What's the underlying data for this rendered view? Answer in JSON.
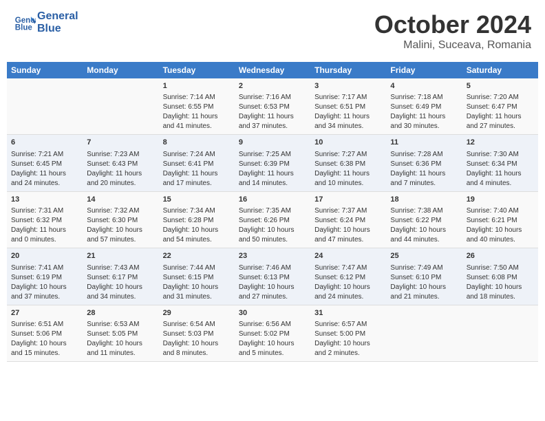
{
  "header": {
    "logo_line1": "General",
    "logo_line2": "Blue",
    "month": "October 2024",
    "location": "Malini, Suceava, Romania"
  },
  "weekdays": [
    "Sunday",
    "Monday",
    "Tuesday",
    "Wednesday",
    "Thursday",
    "Friday",
    "Saturday"
  ],
  "weeks": [
    [
      {
        "day": "",
        "sunrise": "",
        "sunset": "",
        "daylight": ""
      },
      {
        "day": "",
        "sunrise": "",
        "sunset": "",
        "daylight": ""
      },
      {
        "day": "1",
        "sunrise": "Sunrise: 7:14 AM",
        "sunset": "Sunset: 6:55 PM",
        "daylight": "Daylight: 11 hours and 41 minutes."
      },
      {
        "day": "2",
        "sunrise": "Sunrise: 7:16 AM",
        "sunset": "Sunset: 6:53 PM",
        "daylight": "Daylight: 11 hours and 37 minutes."
      },
      {
        "day": "3",
        "sunrise": "Sunrise: 7:17 AM",
        "sunset": "Sunset: 6:51 PM",
        "daylight": "Daylight: 11 hours and 34 minutes."
      },
      {
        "day": "4",
        "sunrise": "Sunrise: 7:18 AM",
        "sunset": "Sunset: 6:49 PM",
        "daylight": "Daylight: 11 hours and 30 minutes."
      },
      {
        "day": "5",
        "sunrise": "Sunrise: 7:20 AM",
        "sunset": "Sunset: 6:47 PM",
        "daylight": "Daylight: 11 hours and 27 minutes."
      }
    ],
    [
      {
        "day": "6",
        "sunrise": "Sunrise: 7:21 AM",
        "sunset": "Sunset: 6:45 PM",
        "daylight": "Daylight: 11 hours and 24 minutes."
      },
      {
        "day": "7",
        "sunrise": "Sunrise: 7:23 AM",
        "sunset": "Sunset: 6:43 PM",
        "daylight": "Daylight: 11 hours and 20 minutes."
      },
      {
        "day": "8",
        "sunrise": "Sunrise: 7:24 AM",
        "sunset": "Sunset: 6:41 PM",
        "daylight": "Daylight: 11 hours and 17 minutes."
      },
      {
        "day": "9",
        "sunrise": "Sunrise: 7:25 AM",
        "sunset": "Sunset: 6:39 PM",
        "daylight": "Daylight: 11 hours and 14 minutes."
      },
      {
        "day": "10",
        "sunrise": "Sunrise: 7:27 AM",
        "sunset": "Sunset: 6:38 PM",
        "daylight": "Daylight: 11 hours and 10 minutes."
      },
      {
        "day": "11",
        "sunrise": "Sunrise: 7:28 AM",
        "sunset": "Sunset: 6:36 PM",
        "daylight": "Daylight: 11 hours and 7 minutes."
      },
      {
        "day": "12",
        "sunrise": "Sunrise: 7:30 AM",
        "sunset": "Sunset: 6:34 PM",
        "daylight": "Daylight: 11 hours and 4 minutes."
      }
    ],
    [
      {
        "day": "13",
        "sunrise": "Sunrise: 7:31 AM",
        "sunset": "Sunset: 6:32 PM",
        "daylight": "Daylight: 11 hours and 0 minutes."
      },
      {
        "day": "14",
        "sunrise": "Sunrise: 7:32 AM",
        "sunset": "Sunset: 6:30 PM",
        "daylight": "Daylight: 10 hours and 57 minutes."
      },
      {
        "day": "15",
        "sunrise": "Sunrise: 7:34 AM",
        "sunset": "Sunset: 6:28 PM",
        "daylight": "Daylight: 10 hours and 54 minutes."
      },
      {
        "day": "16",
        "sunrise": "Sunrise: 7:35 AM",
        "sunset": "Sunset: 6:26 PM",
        "daylight": "Daylight: 10 hours and 50 minutes."
      },
      {
        "day": "17",
        "sunrise": "Sunrise: 7:37 AM",
        "sunset": "Sunset: 6:24 PM",
        "daylight": "Daylight: 10 hours and 47 minutes."
      },
      {
        "day": "18",
        "sunrise": "Sunrise: 7:38 AM",
        "sunset": "Sunset: 6:22 PM",
        "daylight": "Daylight: 10 hours and 44 minutes."
      },
      {
        "day": "19",
        "sunrise": "Sunrise: 7:40 AM",
        "sunset": "Sunset: 6:21 PM",
        "daylight": "Daylight: 10 hours and 40 minutes."
      }
    ],
    [
      {
        "day": "20",
        "sunrise": "Sunrise: 7:41 AM",
        "sunset": "Sunset: 6:19 PM",
        "daylight": "Daylight: 10 hours and 37 minutes."
      },
      {
        "day": "21",
        "sunrise": "Sunrise: 7:43 AM",
        "sunset": "Sunset: 6:17 PM",
        "daylight": "Daylight: 10 hours and 34 minutes."
      },
      {
        "day": "22",
        "sunrise": "Sunrise: 7:44 AM",
        "sunset": "Sunset: 6:15 PM",
        "daylight": "Daylight: 10 hours and 31 minutes."
      },
      {
        "day": "23",
        "sunrise": "Sunrise: 7:46 AM",
        "sunset": "Sunset: 6:13 PM",
        "daylight": "Daylight: 10 hours and 27 minutes."
      },
      {
        "day": "24",
        "sunrise": "Sunrise: 7:47 AM",
        "sunset": "Sunset: 6:12 PM",
        "daylight": "Daylight: 10 hours and 24 minutes."
      },
      {
        "day": "25",
        "sunrise": "Sunrise: 7:49 AM",
        "sunset": "Sunset: 6:10 PM",
        "daylight": "Daylight: 10 hours and 21 minutes."
      },
      {
        "day": "26",
        "sunrise": "Sunrise: 7:50 AM",
        "sunset": "Sunset: 6:08 PM",
        "daylight": "Daylight: 10 hours and 18 minutes."
      }
    ],
    [
      {
        "day": "27",
        "sunrise": "Sunrise: 6:51 AM",
        "sunset": "Sunset: 5:06 PM",
        "daylight": "Daylight: 10 hours and 15 minutes."
      },
      {
        "day": "28",
        "sunrise": "Sunrise: 6:53 AM",
        "sunset": "Sunset: 5:05 PM",
        "daylight": "Daylight: 10 hours and 11 minutes."
      },
      {
        "day": "29",
        "sunrise": "Sunrise: 6:54 AM",
        "sunset": "Sunset: 5:03 PM",
        "daylight": "Daylight: 10 hours and 8 minutes."
      },
      {
        "day": "30",
        "sunrise": "Sunrise: 6:56 AM",
        "sunset": "Sunset: 5:02 PM",
        "daylight": "Daylight: 10 hours and 5 minutes."
      },
      {
        "day": "31",
        "sunrise": "Sunrise: 6:57 AM",
        "sunset": "Sunset: 5:00 PM",
        "daylight": "Daylight: 10 hours and 2 minutes."
      },
      {
        "day": "",
        "sunrise": "",
        "sunset": "",
        "daylight": ""
      },
      {
        "day": "",
        "sunrise": "",
        "sunset": "",
        "daylight": ""
      }
    ]
  ]
}
